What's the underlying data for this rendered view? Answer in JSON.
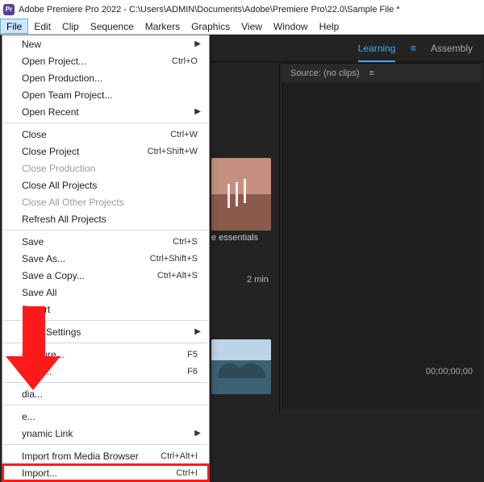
{
  "titlebar": {
    "app_icon_text": "Pr",
    "title": "Adobe Premiere Pro 2022 - C:\\Users\\ADMIN\\Documents\\Adobe\\Premiere Pro\\22.0\\Sample File *"
  },
  "menubar": {
    "items": [
      "File",
      "Edit",
      "Clip",
      "Sequence",
      "Markers",
      "Graphics",
      "View",
      "Window",
      "Help"
    ],
    "active_index": 0
  },
  "workspace": {
    "learning": "Learning",
    "assembly": "Assembly"
  },
  "source_panel": {
    "label": "Source: (no clips)"
  },
  "timecode": "00;00;00;00",
  "thumbs": {
    "essentials_label": "e essentials",
    "duration_label": "2 min"
  },
  "file_menu": {
    "groups": [
      [
        {
          "label": "New",
          "shortcut": "",
          "submenu": true
        },
        {
          "label": "Open Project...",
          "shortcut": "Ctrl+O"
        },
        {
          "label": "Open Production..."
        },
        {
          "label": "Open Team Project..."
        },
        {
          "label": "Open Recent",
          "submenu": true
        }
      ],
      [
        {
          "label": "Close",
          "shortcut": "Ctrl+W"
        },
        {
          "label": "Close Project",
          "shortcut": "Ctrl+Shift+W"
        },
        {
          "label": "Close Production",
          "disabled": true
        },
        {
          "label": "Close All Projects"
        },
        {
          "label": "Close All Other Projects",
          "disabled": true
        },
        {
          "label": "Refresh All Projects"
        }
      ],
      [
        {
          "label": "Save",
          "shortcut": "Ctrl+S"
        },
        {
          "label": "Save As...",
          "shortcut": "Ctrl+Shift+S"
        },
        {
          "label": "Save a Copy...",
          "shortcut": "Ctrl+Alt+S"
        },
        {
          "label": "Save All"
        },
        {
          "label": "Revert"
        }
      ],
      [
        {
          "label": "Sync Settings",
          "submenu": true
        }
      ],
      [
        {
          "label": "Capture...",
          "shortcut": "F5"
        },
        {
          "label": "pture...",
          "shortcut": "F6",
          "obscured": true
        }
      ],
      [
        {
          "label": "dia...",
          "obscured": true
        }
      ],
      [
        {
          "label": "e...",
          "obscured": true
        },
        {
          "label": "ynamic Link",
          "submenu": true,
          "obscured": true
        }
      ],
      [
        {
          "label": "Import from Media Browser",
          "shortcut": "Ctrl+Alt+I"
        },
        {
          "label": "Import...",
          "shortcut": "Ctrl+I",
          "highlight": true
        }
      ]
    ]
  }
}
